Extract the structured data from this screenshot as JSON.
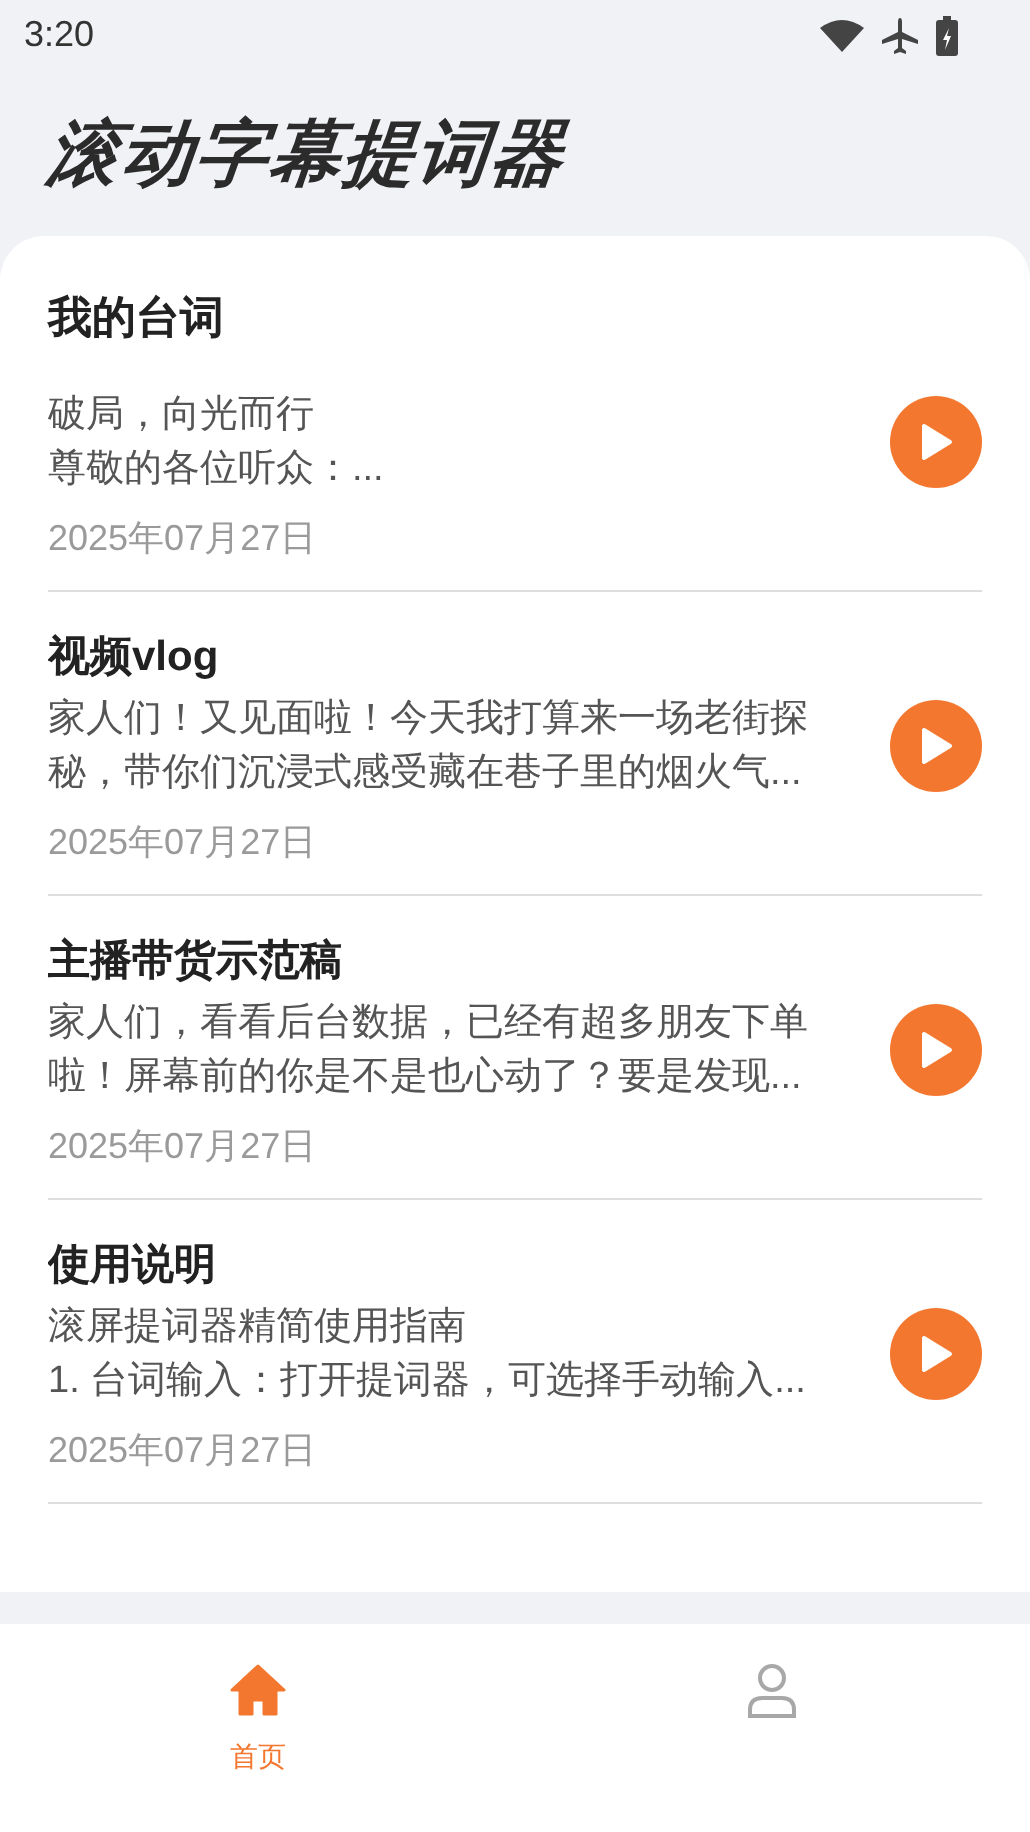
{
  "status_bar": {
    "time": "3:20"
  },
  "app_title": "滚动字幕提词器",
  "section_title": "我的台词",
  "scripts": [
    {
      "body": [
        "破局，向光而行",
        "尊敬的各位听众：..."
      ],
      "date": "2025年07月27日"
    },
    {
      "title": "视频vlog",
      "body": [
        "家人们！又见面啦！今天我打算来一场老街探秘，带你们沉浸式感受藏在巷子里的烟火气..."
      ],
      "date": "2025年07月27日"
    },
    {
      "title": "主播带货示范稿",
      "body": [
        "家人们，看看后台数据，已经有超多朋友下单啦！屏幕前的你是不是也心动了？要是发现..."
      ],
      "date": "2025年07月27日"
    },
    {
      "title": "使用说明",
      "body": [
        "滚屏提词器精简使用指南",
        "1. 台词输入：打开提词器，可选择手动输入..."
      ],
      "date": "2025年07月27日"
    }
  ],
  "nav": [
    {
      "kind": "home",
      "label": "首页",
      "selected": true
    },
    {
      "kind": "profile",
      "selected": false
    }
  ]
}
